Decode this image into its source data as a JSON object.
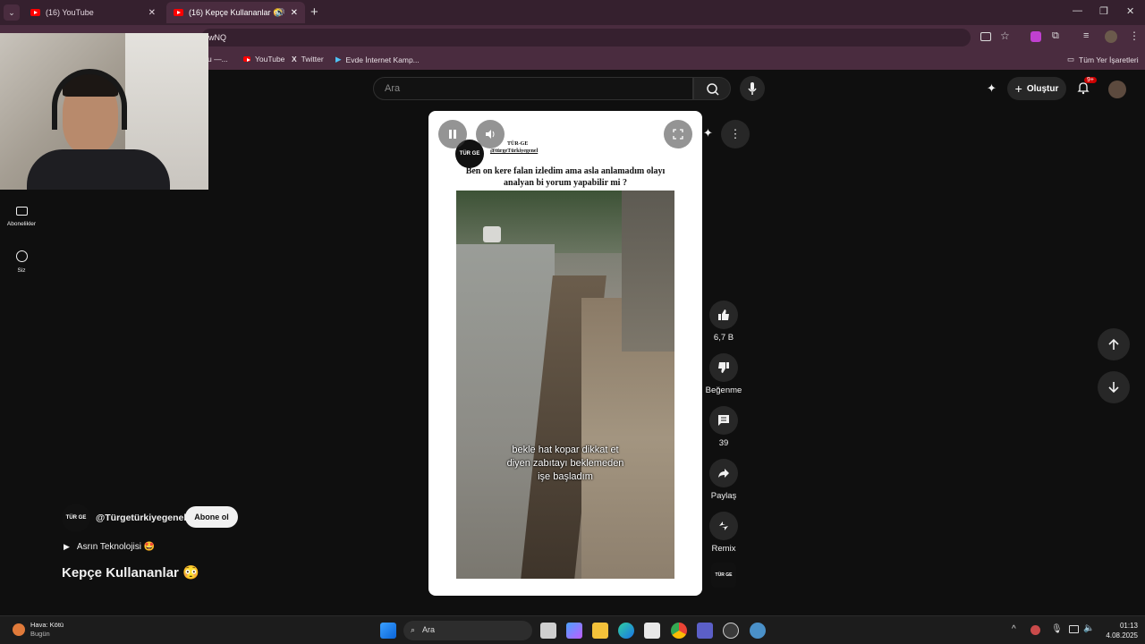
{
  "browser": {
    "tabs": [
      {
        "title": "(16) YouTube",
        "active": false
      },
      {
        "title": "(16) Kepçe Kullananlar 😳",
        "active": true
      }
    ],
    "address_fragment": "wNQ",
    "bookmarks": [
      "u —...",
      "YouTube",
      "Twitter",
      "Evde İnternet Kamp...",
      "Tüm Yer İşaretleri"
    ]
  },
  "header": {
    "search_placeholder": "Ara",
    "create_label": "Oluştur",
    "notification_badge": "9+"
  },
  "sidebar": {
    "items": [
      {
        "label": "Abonelikler",
        "icon": "subscriptions-icon"
      },
      {
        "label": "Siz",
        "icon": "you-icon"
      }
    ]
  },
  "short": {
    "overlay_channel": "TÜR-GE",
    "overlay_handle": "@türgeTürkiyegenel",
    "caption": "Ben on kere falan izledim ama asla anlamadım olayı analyan bi yorum yapabilir mi ?",
    "subtitle_lines": [
      "bekle hat kopar dikkat et",
      "diyen zabıtayı beklemeden",
      "işe başladım"
    ],
    "logo_text": "TÜR GE"
  },
  "actions": {
    "likes": "6,7 B",
    "dislike_label": "Beğenme",
    "comments": "39",
    "share_label": "Paylaş",
    "remix_label": "Remix",
    "channel_thumb_text": "TÜR GE"
  },
  "channel": {
    "handle": "@Türgetürkiyegenel",
    "subscribe_label": "Abone ol",
    "music": "Asrın Teknolojisi 🤩",
    "title": "Kepçe Kullananlar 😳"
  },
  "taskbar": {
    "weather_title": "Hava: Kötü",
    "weather_sub": "Bugün",
    "search_label": "Ara",
    "time": "01:13",
    "date": "4.08.2025"
  },
  "colors": {
    "tab_bg": "#35202e",
    "chrome_bg": "#4a2c3f",
    "page_bg": "#0f0f0f",
    "accent_red": "#ff0000"
  }
}
